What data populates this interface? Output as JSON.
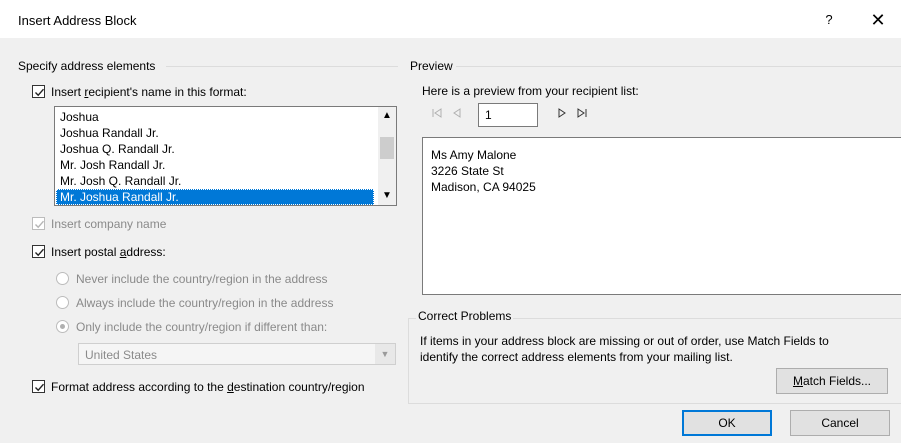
{
  "window": {
    "title": "Insert Address Block",
    "help_label": "?",
    "close_label": "✕"
  },
  "left": {
    "group_label": "Specify address elements",
    "name_format_checkbox": {
      "label": "Insert recipient's name in this format:",
      "checked": true
    },
    "name_formats": [
      "Joshua",
      "Joshua Randall Jr.",
      "Joshua Q. Randall Jr.",
      "Mr. Josh Randall Jr.",
      "Mr. Josh Q. Randall Jr.",
      "Mr. Joshua Randall Jr."
    ],
    "selected_format_index": 5,
    "company_checkbox": {
      "label": "Insert company name",
      "checked": true,
      "disabled": true
    },
    "postal_checkbox": {
      "label": "Insert postal address:",
      "checked": true
    },
    "country_options": [
      {
        "label": "Never include the country/region in the address",
        "selected": false
      },
      {
        "label": "Always include the country/region in the address",
        "selected": false
      },
      {
        "label": "Only include the country/region if different than:",
        "selected": true
      }
    ],
    "country_combo_value": "United States",
    "format_checkbox": {
      "label": "Format address according to the destination country/region",
      "checked": true
    }
  },
  "right": {
    "group_label": "Preview",
    "preview_caption": "Here is a preview from your recipient list:",
    "record_number": "1",
    "preview_lines": [
      "Ms Amy Malone",
      "3226 State St",
      "Madison, CA 94025"
    ],
    "correct_label": "Correct Problems",
    "correct_text_1": "If items in your address block are missing or out of order, use Match Fields to",
    "correct_text_2": "identify the correct address elements from your mailing list.",
    "match_fields_label": "Match Fields..."
  },
  "footer": {
    "ok_label": "OK",
    "cancel_label": "Cancel"
  },
  "colors": {
    "selection": "#0078d7",
    "dialog_bg": "#f0f0f0"
  }
}
